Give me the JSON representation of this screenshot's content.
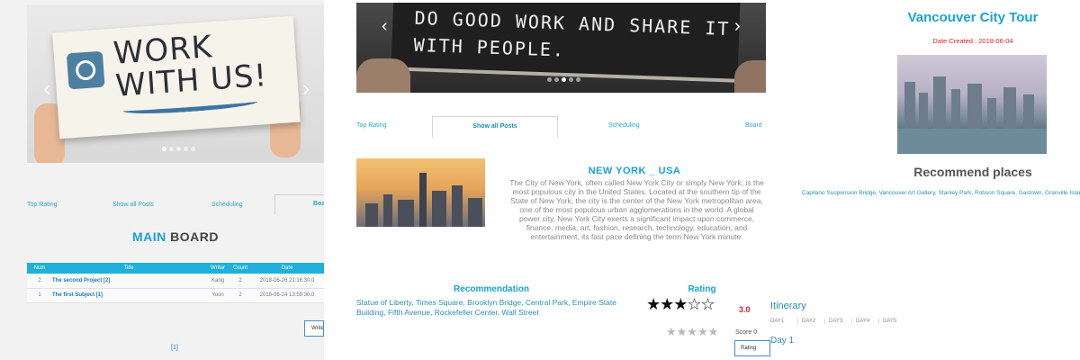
{
  "panel_board": {
    "hero": {
      "sign_text": "WORK WITH US!",
      "prev_arrow": "‹",
      "next_arrow": "›"
    },
    "tabs": [
      "Top Rating",
      "Show all Posts",
      "Scheduling",
      "Boa"
    ],
    "title_accent": "MAIN",
    "title_rest": " BOARD",
    "table": {
      "headers": [
        "Num",
        "Title",
        "Writer",
        "Count",
        "Date"
      ],
      "rows": [
        {
          "num": "2",
          "title": "The second Project [2]",
          "writer": "Kang",
          "count": "2",
          "date": "2018-06-26 21:16:30.0"
        },
        {
          "num": "1",
          "title": "The first Subject [1]",
          "writer": "Yoon",
          "count": "2",
          "date": "2018-06-24 13:59:30.0"
        }
      ]
    },
    "write_button": "Write",
    "pager": "[1]"
  },
  "panel_city": {
    "hero": {
      "quote": "DO GOOD WORK AND SHARE IT WITH PEOPLE.",
      "prev_arrow": "‹",
      "next_arrow": "›"
    },
    "tabs": [
      "Top Rating",
      "Show all Posts",
      "Scheduling",
      "Board"
    ],
    "city_title": "NEW YORK _ USA",
    "city_description": "The City of New York, often called New York City or simply New York, is the most populous city in the United States. Located at the southern tip of the State of New York, the city is the center of the New York metropolitan area, one of the most populous urban agglomerations in the world. A global power city, New York City exerts a significant impact upon commerce, finance, media, art, fashion, research, technology, education, and entertainment, its fast pace defining the term New York minute.",
    "recommendation_heading": "Recommendation",
    "recommendation_text": "Statue of Liberty, Times Square, Brooklyn Bridge, Central Park, Empire State Building, Fifth Avenue, Rockefeller Center, Wall Street",
    "rating_heading": "Rating",
    "rating_stars": "★★★☆☆",
    "rating_value": 3.0,
    "rating_score_text": "3.0",
    "rating_input_stars": "★★★★★",
    "score_label": "Score 0",
    "rating_button": "Rating"
  },
  "panel_tour": {
    "title": "Vancouver City Tour",
    "date_created": "Date Created : 2018-06-04",
    "recommend_heading": "Recommend places",
    "places": "Capilano Suspension Bridge, Vancouver Art Gallery, Stanley Park, Robson Square, Gastown, Granville Island, FlyOver Canada, Vancouver Art Gallery",
    "itinerary_heading": "Itinerary",
    "day_tabs": [
      "DAY1",
      "DAY2",
      "DAY3",
      "DAY4",
      "DAY5"
    ],
    "day_label": "Day 1"
  },
  "colors": {
    "accent": "#1aa3d3",
    "table_header": "#1fb1db",
    "date_red": "#e02020",
    "score_red": "#d62222"
  }
}
